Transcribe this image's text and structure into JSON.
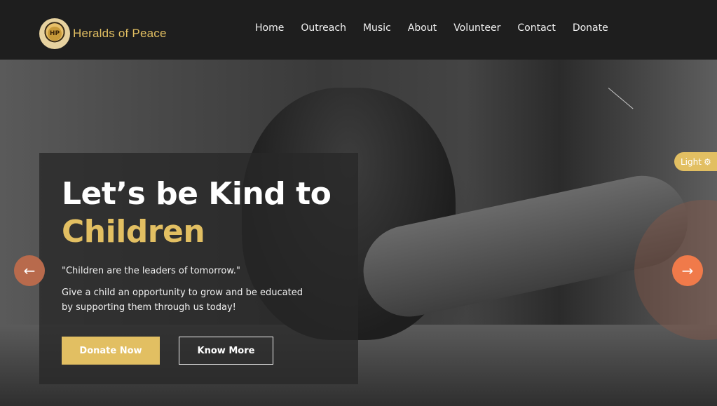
{
  "header": {
    "logo_text": "Heralds of Peace",
    "logo_mark": "HP",
    "nav": [
      "Home",
      "Outreach",
      "Music",
      "About",
      "Volunteer",
      "Contact",
      "Donate"
    ]
  },
  "hero": {
    "headline_line1": "Let’s be Kind to",
    "headline_line2": "Children",
    "quote": "\"Children are the leaders of tomorrow.\"",
    "description": "Give a child an opportunity to grow and be educated by supporting them through us today!",
    "donate_label": "Donate Now",
    "more_label": "Know More",
    "prev_arrow": "←",
    "next_arrow": "→"
  },
  "theme_toggle": {
    "label": "Light",
    "icon": "palette-icon",
    "icon_glyph": "⚙"
  },
  "colors": {
    "accent": "#e2bf62",
    "nav_bg": "#1e1e1e",
    "arrow_next": "#f07a4a",
    "arrow_prev": "#b86a4c"
  }
}
